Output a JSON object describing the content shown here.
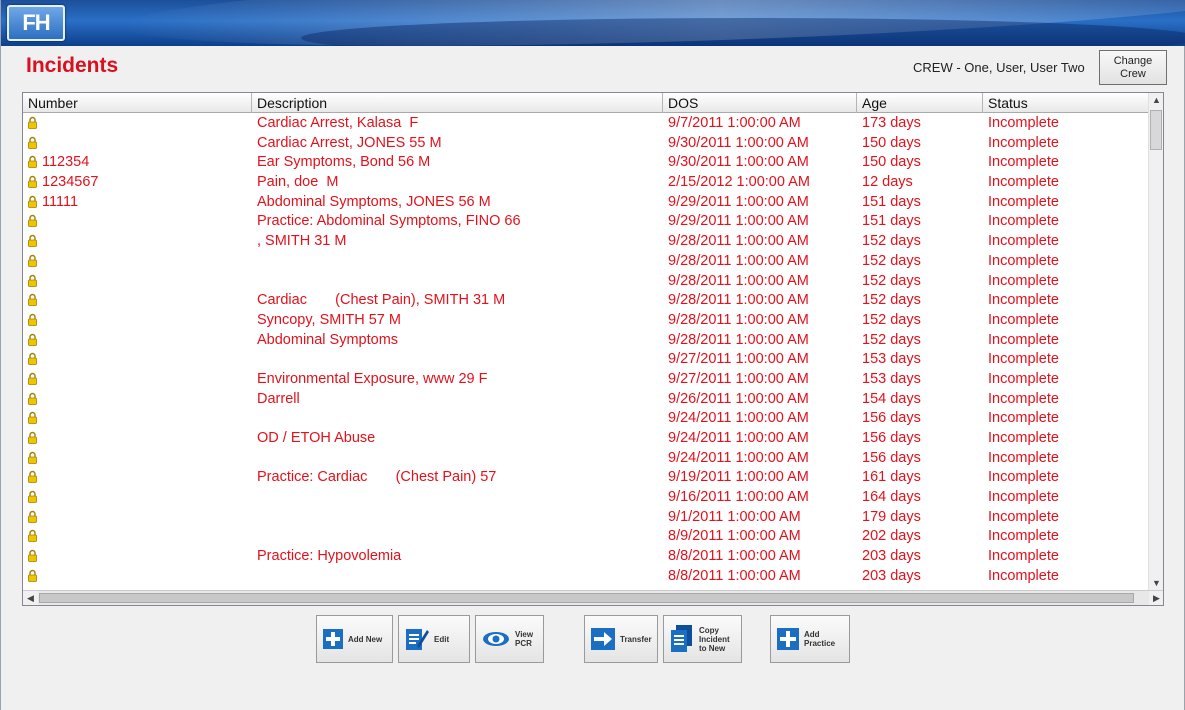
{
  "app": {
    "logo_text": "FH"
  },
  "page": {
    "title": "Incidents"
  },
  "crew": {
    "text": "CREW - One, User, User Two",
    "change_label_1": "Change",
    "change_label_2": "Crew"
  },
  "table": {
    "columns": [
      "Number",
      "Description",
      "DOS",
      "Age",
      "Status"
    ],
    "rows": [
      {
        "number": "",
        "description": "Cardiac Arrest, Kalasa  F",
        "dos": "9/7/2011 1:00:00 AM",
        "age": "173 days",
        "status": "Incomplete"
      },
      {
        "number": "",
        "description": "Cardiac Arrest, JONES 55 M",
        "dos": "9/30/2011 1:00:00 AM",
        "age": "150 days",
        "status": "Incomplete"
      },
      {
        "number": "112354",
        "description": "Ear Symptoms, Bond 56 M",
        "dos": "9/30/2011 1:00:00 AM",
        "age": "150 days",
        "status": "Incomplete"
      },
      {
        "number": "1234567",
        "description": "Pain, doe  M",
        "dos": "2/15/2012 1:00:00 AM",
        "age": "12 days",
        "status": "Incomplete"
      },
      {
        "number": "11111",
        "description": "Abdominal Symptoms, JONES 56 M",
        "dos": "9/29/2011 1:00:00 AM",
        "age": "151 days",
        "status": "Incomplete"
      },
      {
        "number": "",
        "description": "Practice: Abdominal Symptoms, FINO 66",
        "dos": "9/29/2011 1:00:00 AM",
        "age": "151 days",
        "status": "Incomplete"
      },
      {
        "number": "",
        "description": ", SMITH 31 M",
        "dos": "9/28/2011 1:00:00 AM",
        "age": "152 days",
        "status": "Incomplete"
      },
      {
        "number": "",
        "description": "",
        "dos": "9/28/2011 1:00:00 AM",
        "age": "152 days",
        "status": "Incomplete"
      },
      {
        "number": "",
        "description": "",
        "dos": "9/28/2011 1:00:00 AM",
        "age": "152 days",
        "status": "Incomplete"
      },
      {
        "number": "",
        "description": "Cardiac       (Chest Pain), SMITH 31 M",
        "dos": "9/28/2011 1:00:00 AM",
        "age": "152 days",
        "status": "Incomplete"
      },
      {
        "number": "",
        "description": "Syncopy, SMITH 57 M",
        "dos": "9/28/2011 1:00:00 AM",
        "age": "152 days",
        "status": "Incomplete"
      },
      {
        "number": "",
        "description": "Abdominal Symptoms",
        "dos": "9/28/2011 1:00:00 AM",
        "age": "152 days",
        "status": "Incomplete"
      },
      {
        "number": "",
        "description": "",
        "dos": "9/27/2011 1:00:00 AM",
        "age": "153 days",
        "status": "Incomplete"
      },
      {
        "number": "",
        "description": "Environmental Exposure, www 29 F",
        "dos": "9/27/2011 1:00:00 AM",
        "age": "153 days",
        "status": "Incomplete"
      },
      {
        "number": "",
        "description": "Darrell",
        "dos": "9/26/2011 1:00:00 AM",
        "age": "154 days",
        "status": "Incomplete"
      },
      {
        "number": "",
        "description": "",
        "dos": "9/24/2011 1:00:00 AM",
        "age": "156 days",
        "status": "Incomplete"
      },
      {
        "number": "",
        "description": "OD / ETOH Abuse",
        "dos": "9/24/2011 1:00:00 AM",
        "age": "156 days",
        "status": "Incomplete"
      },
      {
        "number": "",
        "description": "",
        "dos": "9/24/2011 1:00:00 AM",
        "age": "156 days",
        "status": "Incomplete"
      },
      {
        "number": "",
        "description": "Practice: Cardiac       (Chest Pain) 57",
        "dos": "9/19/2011 1:00:00 AM",
        "age": "161 days",
        "status": "Incomplete"
      },
      {
        "number": "",
        "description": "",
        "dos": "9/16/2011 1:00:00 AM",
        "age": "164 days",
        "status": "Incomplete"
      },
      {
        "number": "",
        "description": "",
        "dos": "9/1/2011 1:00:00 AM",
        "age": "179 days",
        "status": "Incomplete"
      },
      {
        "number": "",
        "description": "",
        "dos": "8/9/2011 1:00:00 AM",
        "age": "202 days",
        "status": "Incomplete"
      },
      {
        "number": "",
        "description": "Practice: Hypovolemia",
        "dos": "8/8/2011 1:00:00 AM",
        "age": "203 days",
        "status": "Incomplete"
      },
      {
        "number": "",
        "description": "",
        "dos": "8/8/2011 1:00:00 AM",
        "age": "203 days",
        "status": "Incomplete"
      }
    ]
  },
  "toolbar": {
    "add_new": "Add New",
    "edit": "Edit",
    "view_pcr_1": "View",
    "view_pcr_2": "PCR",
    "transfer": "Transfer",
    "copy_1": "Copy",
    "copy_2": "Incident",
    "copy_3": "to New",
    "add_practice_1": "Add",
    "add_practice_2": "Practice"
  },
  "colors": {
    "title": "#d91020",
    "row_text": "#e3111c",
    "banner": "#1c4f9a"
  }
}
